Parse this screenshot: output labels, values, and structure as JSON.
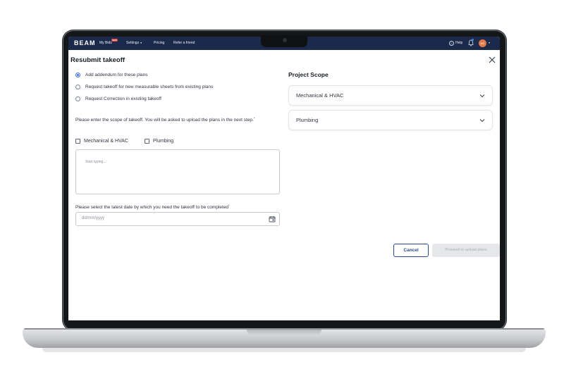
{
  "nav": {
    "logo": "BEAM",
    "my_bids": "My Bids",
    "my_bids_badge": "NEW",
    "settings": "Settings",
    "pricing": "Pricing",
    "refer": "Refer a friend",
    "help": "Help",
    "avatar_initials": "KG"
  },
  "modal": {
    "title": "Resubmit takeoff",
    "radio_options": [
      {
        "label": "Add addendum for these plans",
        "checked": true
      },
      {
        "label": "Request takeoff for new measurable sheets from existing plans",
        "checked": false
      },
      {
        "label": "Request Correction in existing takeoff",
        "checked": false
      }
    ],
    "scope_instructions": "Please enter the scope of takeoff. You will be asked to upload the plans in the next step.",
    "required_mark": "*",
    "checkboxes": [
      {
        "label": "Mechanical & HVAC",
        "checked": false
      },
      {
        "label": "Plumbing",
        "checked": false
      }
    ],
    "textarea_placeholder": "Start typing...",
    "date_label": "Please select the latest date by which you need the takeoff to be completed",
    "date_required_mark": "*",
    "date_placeholder": "dd/mm/yyyy",
    "cancel_label": "Cancel",
    "proceed_label": "Proceed to upload plans"
  },
  "project_scope": {
    "title": "Project Scope",
    "items": [
      {
        "label": "Mechanical & HVAC"
      },
      {
        "label": "Plumbing"
      }
    ]
  },
  "colors": {
    "nav_bg": "#1b2a4a",
    "accent": "#3b6ef5",
    "cancel": "#2c4a8a",
    "disabled_bg": "#e6e7ea"
  }
}
